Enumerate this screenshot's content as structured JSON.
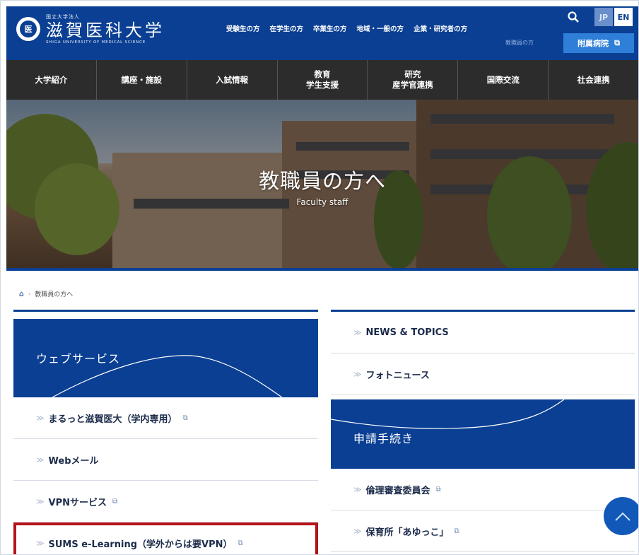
{
  "header": {
    "logo_small": "国立大学法人",
    "logo_main": "滋賀医科大学",
    "logo_en": "SHIGA UNIVERSITY OF MEDICAL SCIENCE",
    "logo_mark": "医",
    "top_links": [
      "受験生の方",
      "在学生の方",
      "卒業生の方",
      "地域・一般の方",
      "企業・研究者の方"
    ],
    "sub_link": "教職員の方",
    "lang_jp": "JP",
    "lang_en": "EN",
    "hospital": "附属病院"
  },
  "nav": [
    "大学紹介",
    "講座・施設",
    "入試情報",
    "教育\n学生支援",
    "研究\n産学官連携",
    "国際交流",
    "社会連携"
  ],
  "hero": {
    "title": "教職員の方へ",
    "subtitle": "Faculty staff"
  },
  "breadcrumb": {
    "current": "教職員の方へ"
  },
  "left": {
    "heading": "ウェブサービス",
    "items": [
      {
        "label": "まるっと滋賀医大（学内専用）",
        "external": true
      },
      {
        "label": "Webメール",
        "external": false
      },
      {
        "label": "VPNサービス",
        "external": true
      },
      {
        "label": "SUMS e-Learning（学外からは要VPN）",
        "external": true
      }
    ]
  },
  "right": {
    "top_items": [
      "NEWS & TOPICS",
      "フォトニュース"
    ],
    "heading": "申請手続き",
    "items": [
      {
        "label": "倫理審査委員会",
        "external": true
      },
      {
        "label": "保育所「あゆっこ」",
        "external": true
      }
    ]
  },
  "colors": {
    "brand": "#0a3f93",
    "highlight": "#b5121b"
  },
  "icons": [
    "search-icon",
    "external-link-icon",
    "home-icon",
    "chevron-right-icon",
    "page-top-icon"
  ]
}
